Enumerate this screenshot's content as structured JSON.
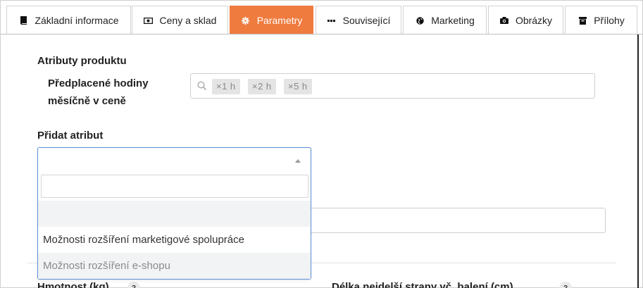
{
  "tabs": [
    {
      "label": "Základní informace",
      "icon": "book-icon",
      "active": false
    },
    {
      "label": "Ceny a sklad",
      "icon": "money-icon",
      "active": false
    },
    {
      "label": "Parametry",
      "icon": "gear-icon",
      "active": true
    },
    {
      "label": "Související",
      "icon": "ellipsis-icon",
      "active": false
    },
    {
      "label": "Marketing",
      "icon": "globe-icon",
      "active": false
    },
    {
      "label": "Obrázky",
      "icon": "camera-icon",
      "active": false
    },
    {
      "label": "Přílohy",
      "icon": "archive-icon",
      "active": false
    }
  ],
  "colors": {
    "accent": "#f07b3f",
    "focus_border": "#5b8fd6"
  },
  "attributes": {
    "title": "Atributy produktu",
    "field_label": "Předplacené hodiny měsíčně v ceně",
    "tags": [
      "×1 h",
      "×2 h",
      "×5 h"
    ]
  },
  "add_attribute": {
    "title": "Přidat atribut",
    "selected": "",
    "search_value": "",
    "options": [
      "",
      "Možnosti rozšíření marketigové spolupráce",
      "Možnosti rozšíření e-shopu"
    ]
  },
  "fields": {
    "weight_label": "Hmotnost (kg)",
    "longest_side_label": "Délka nejdelší strany vč. balení (cm)",
    "help": "?"
  }
}
